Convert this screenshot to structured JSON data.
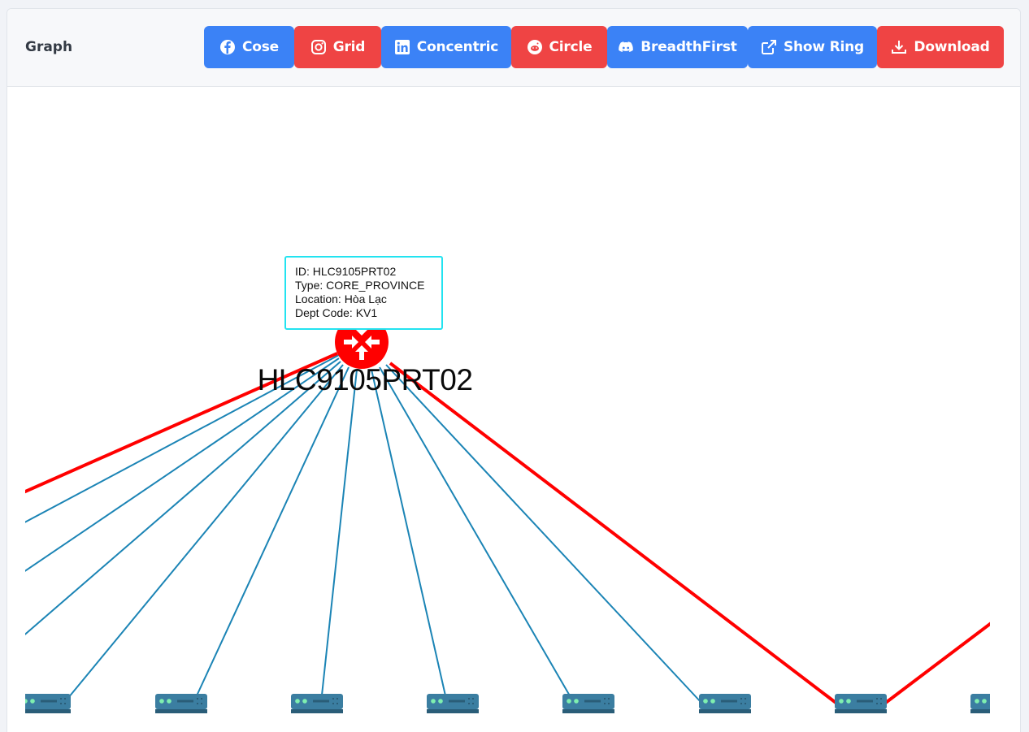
{
  "header": {
    "title": "Graph",
    "buttons": [
      {
        "label": "Cose",
        "icon": "facebook-icon",
        "color": "#3b82f6"
      },
      {
        "label": "Grid",
        "icon": "instagram-icon",
        "color": "#ef4444"
      },
      {
        "label": "Concentric",
        "icon": "linkedin-icon",
        "color": "#3b82f6"
      },
      {
        "label": "Circle",
        "icon": "reddit-icon",
        "color": "#ef4444"
      },
      {
        "label": "BreadthFirst",
        "icon": "discord-icon",
        "color": "#3b82f6"
      },
      {
        "label": "Show Ring",
        "icon": "external-link-icon",
        "color": "#3b82f6"
      },
      {
        "label": "Download",
        "icon": "download-icon",
        "color": "#ef4444"
      }
    ]
  },
  "graph": {
    "center_node": {
      "label": "HLC9105PRT02",
      "icon": "router-icon",
      "color": "#ff0000"
    },
    "tooltip": {
      "id_line": "ID: HLC9105PRT02",
      "type_line": "Type: CORE_PROVINCE",
      "location_line": "Location: Hòa Lạc",
      "dept_line": "Dept Code: KV1"
    },
    "edge_colors": {
      "normal": "#1b84b5",
      "ring": "#ff0000"
    },
    "server_node_icon": "server-icon"
  }
}
